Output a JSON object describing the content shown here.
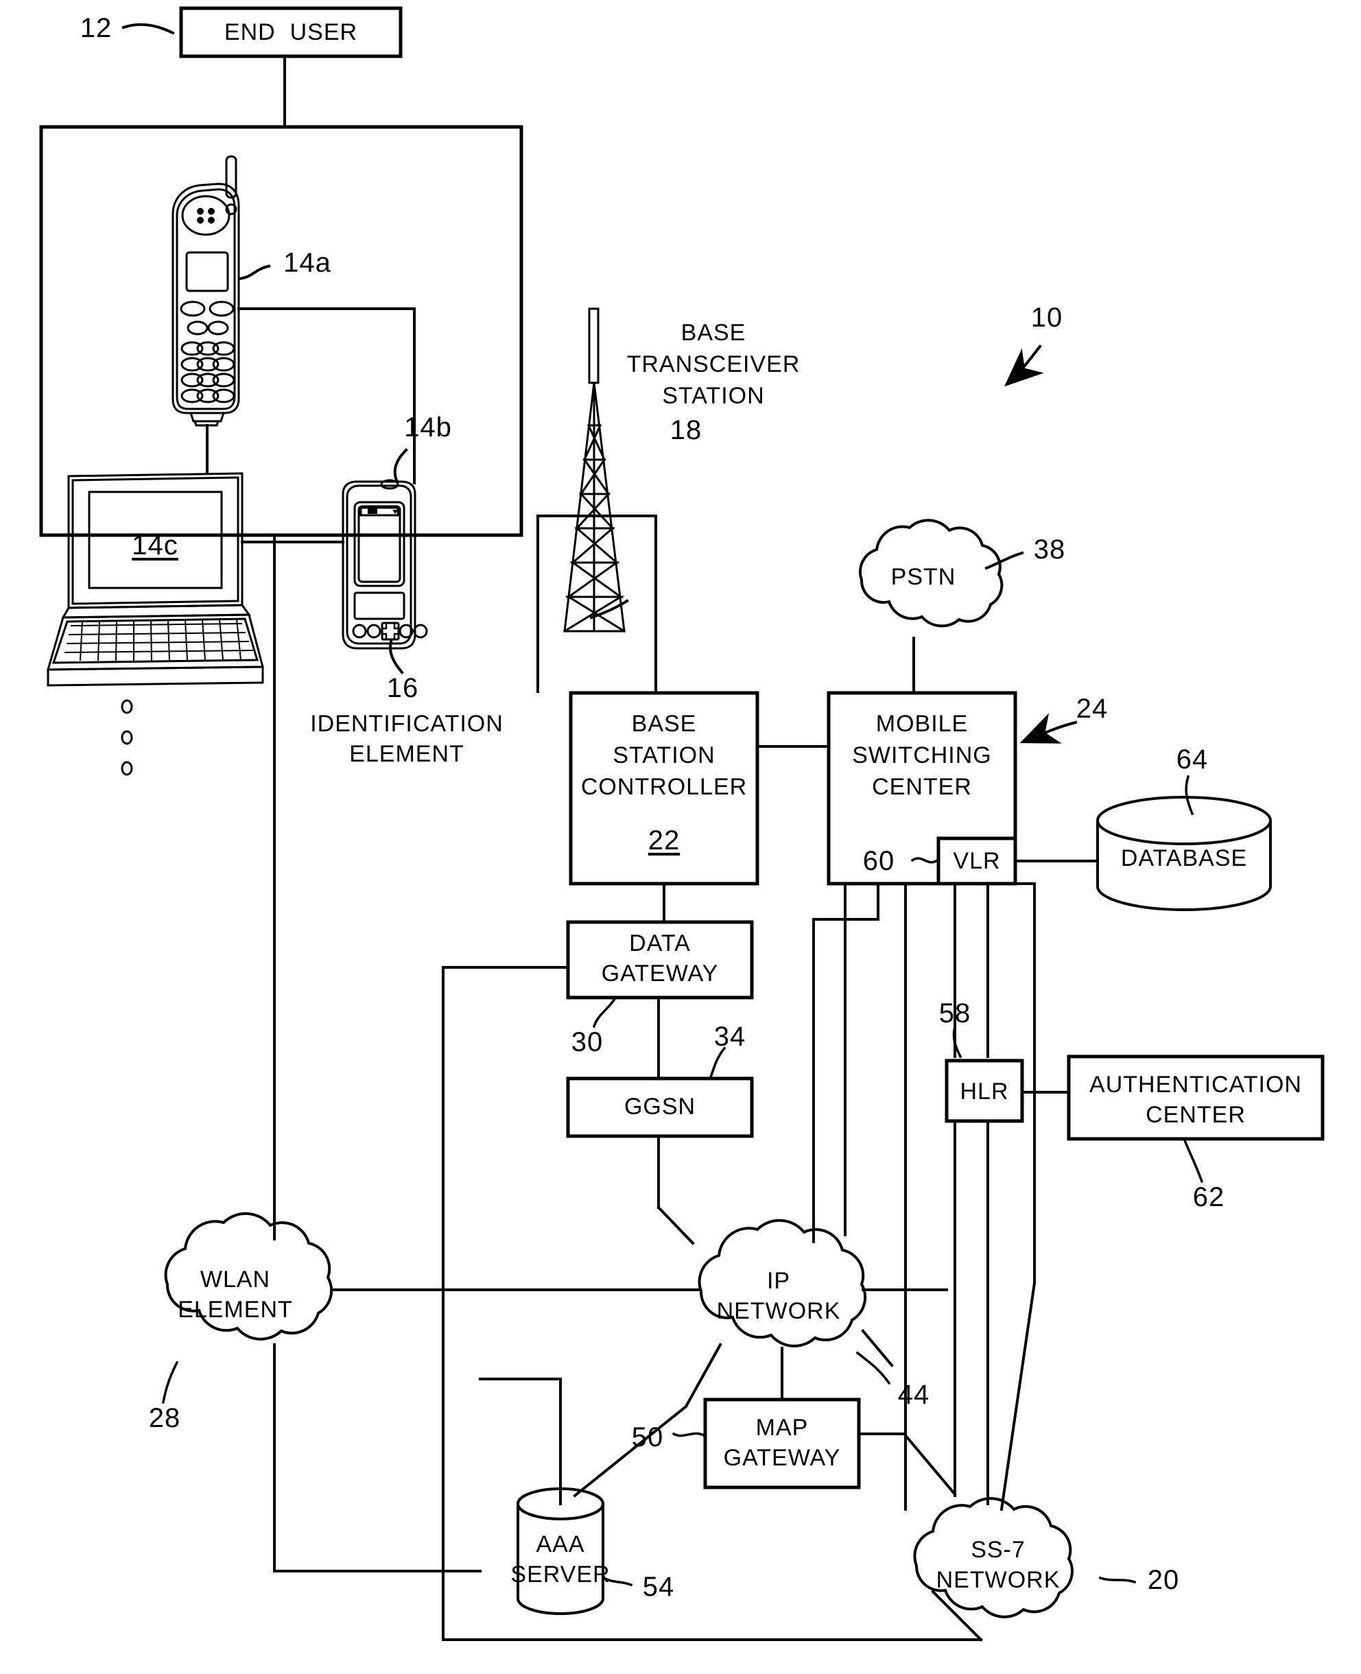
{
  "figure": {
    "type": "patent-network-diagram",
    "overall_ref": "10"
  },
  "nodes": {
    "end_user": {
      "label": "END  USER",
      "ref": "12"
    },
    "mobile_phone": {
      "ref": "14a"
    },
    "pda": {
      "ref": "14b"
    },
    "laptop": {
      "ref": "14c"
    },
    "identification_element": {
      "label": "IDENTIFICATION\nELEMENT",
      "ref": "16"
    },
    "base_transceiver_station": {
      "label": "BASE\nTRANSCEIVER\nSTATION",
      "ref": "18"
    },
    "base_station_controller": {
      "label": "BASE\nSTATION\nCONTROLLER",
      "ref": "22"
    },
    "mobile_switching_center": {
      "label": "MOBILE\nSWITCHING\nCENTER",
      "ref": "24"
    },
    "vlr": {
      "label": "VLR",
      "ref": "60"
    },
    "database": {
      "label": "DATABASE",
      "ref": "64"
    },
    "pstn": {
      "label": "PSTN",
      "ref": "38"
    },
    "data_gateway": {
      "label": "DATA\nGATEWAY",
      "ref": "30"
    },
    "ggsn": {
      "label": "GGSN",
      "ref": "34"
    },
    "hlr": {
      "label": "HLR",
      "ref": "58"
    },
    "authentication_center": {
      "label": "AUTHENTICATION\nCENTER",
      "ref": "62"
    },
    "wlan_element": {
      "label": "WLAN\nELEMENT",
      "ref": "28"
    },
    "ip_network": {
      "label": "IP\nNETWORK",
      "ref": "44"
    },
    "map_gateway": {
      "label": "MAP\nGATEWAY",
      "ref": "50"
    },
    "aaa_server": {
      "label": "AAA\nSERVER",
      "ref": "54"
    },
    "ss7_network": {
      "label": "SS-7\nNETWORK",
      "ref": "20"
    }
  },
  "labels": {
    "end_user": "END  USER",
    "bts_line1": "BASE",
    "bts_line2": "TRANSCEIVER",
    "bts_line3": "STATION",
    "bsc_line1": "BASE",
    "bsc_line2": "STATION",
    "bsc_line3": "CONTROLLER",
    "msc_line1": "MOBILE",
    "msc_line2": "SWITCHING",
    "msc_line3": "CENTER",
    "vlr": "VLR",
    "database": "DATABASE",
    "pstn": "PSTN",
    "dg_line1": "DATA",
    "dg_line2": "GATEWAY",
    "ggsn": "GGSN",
    "hlr": "HLR",
    "ac_line1": "AUTHENTICATION",
    "ac_line2": "CENTER",
    "wlan_line1": "WLAN",
    "wlan_line2": "ELEMENT",
    "ip_line1": "IP",
    "ip_line2": "NETWORK",
    "mapgw_line1": "MAP",
    "mapgw_line2": "GATEWAY",
    "aaa_line1": "AAA",
    "aaa_line2": "SERVER",
    "ss7_line1": "SS-7",
    "ss7_line2": "NETWORK",
    "ident_line1": "IDENTIFICATION",
    "ident_line2": "ELEMENT"
  },
  "refs": {
    "r10": "10",
    "r12": "12",
    "r14a": "14a",
    "r14b": "14b",
    "r14c": "14c",
    "r16": "16",
    "r18": "18",
    "r20": "20",
    "r22": "22",
    "r24": "24",
    "r28": "28",
    "r30": "30",
    "r34": "34",
    "r38": "38",
    "r44": "44",
    "r50": "50",
    "r54": "54",
    "r58": "58",
    "r60": "60",
    "r62": "62",
    "r64": "64"
  },
  "colors": {
    "ink": "#000000",
    "paper": "#ffffff"
  }
}
